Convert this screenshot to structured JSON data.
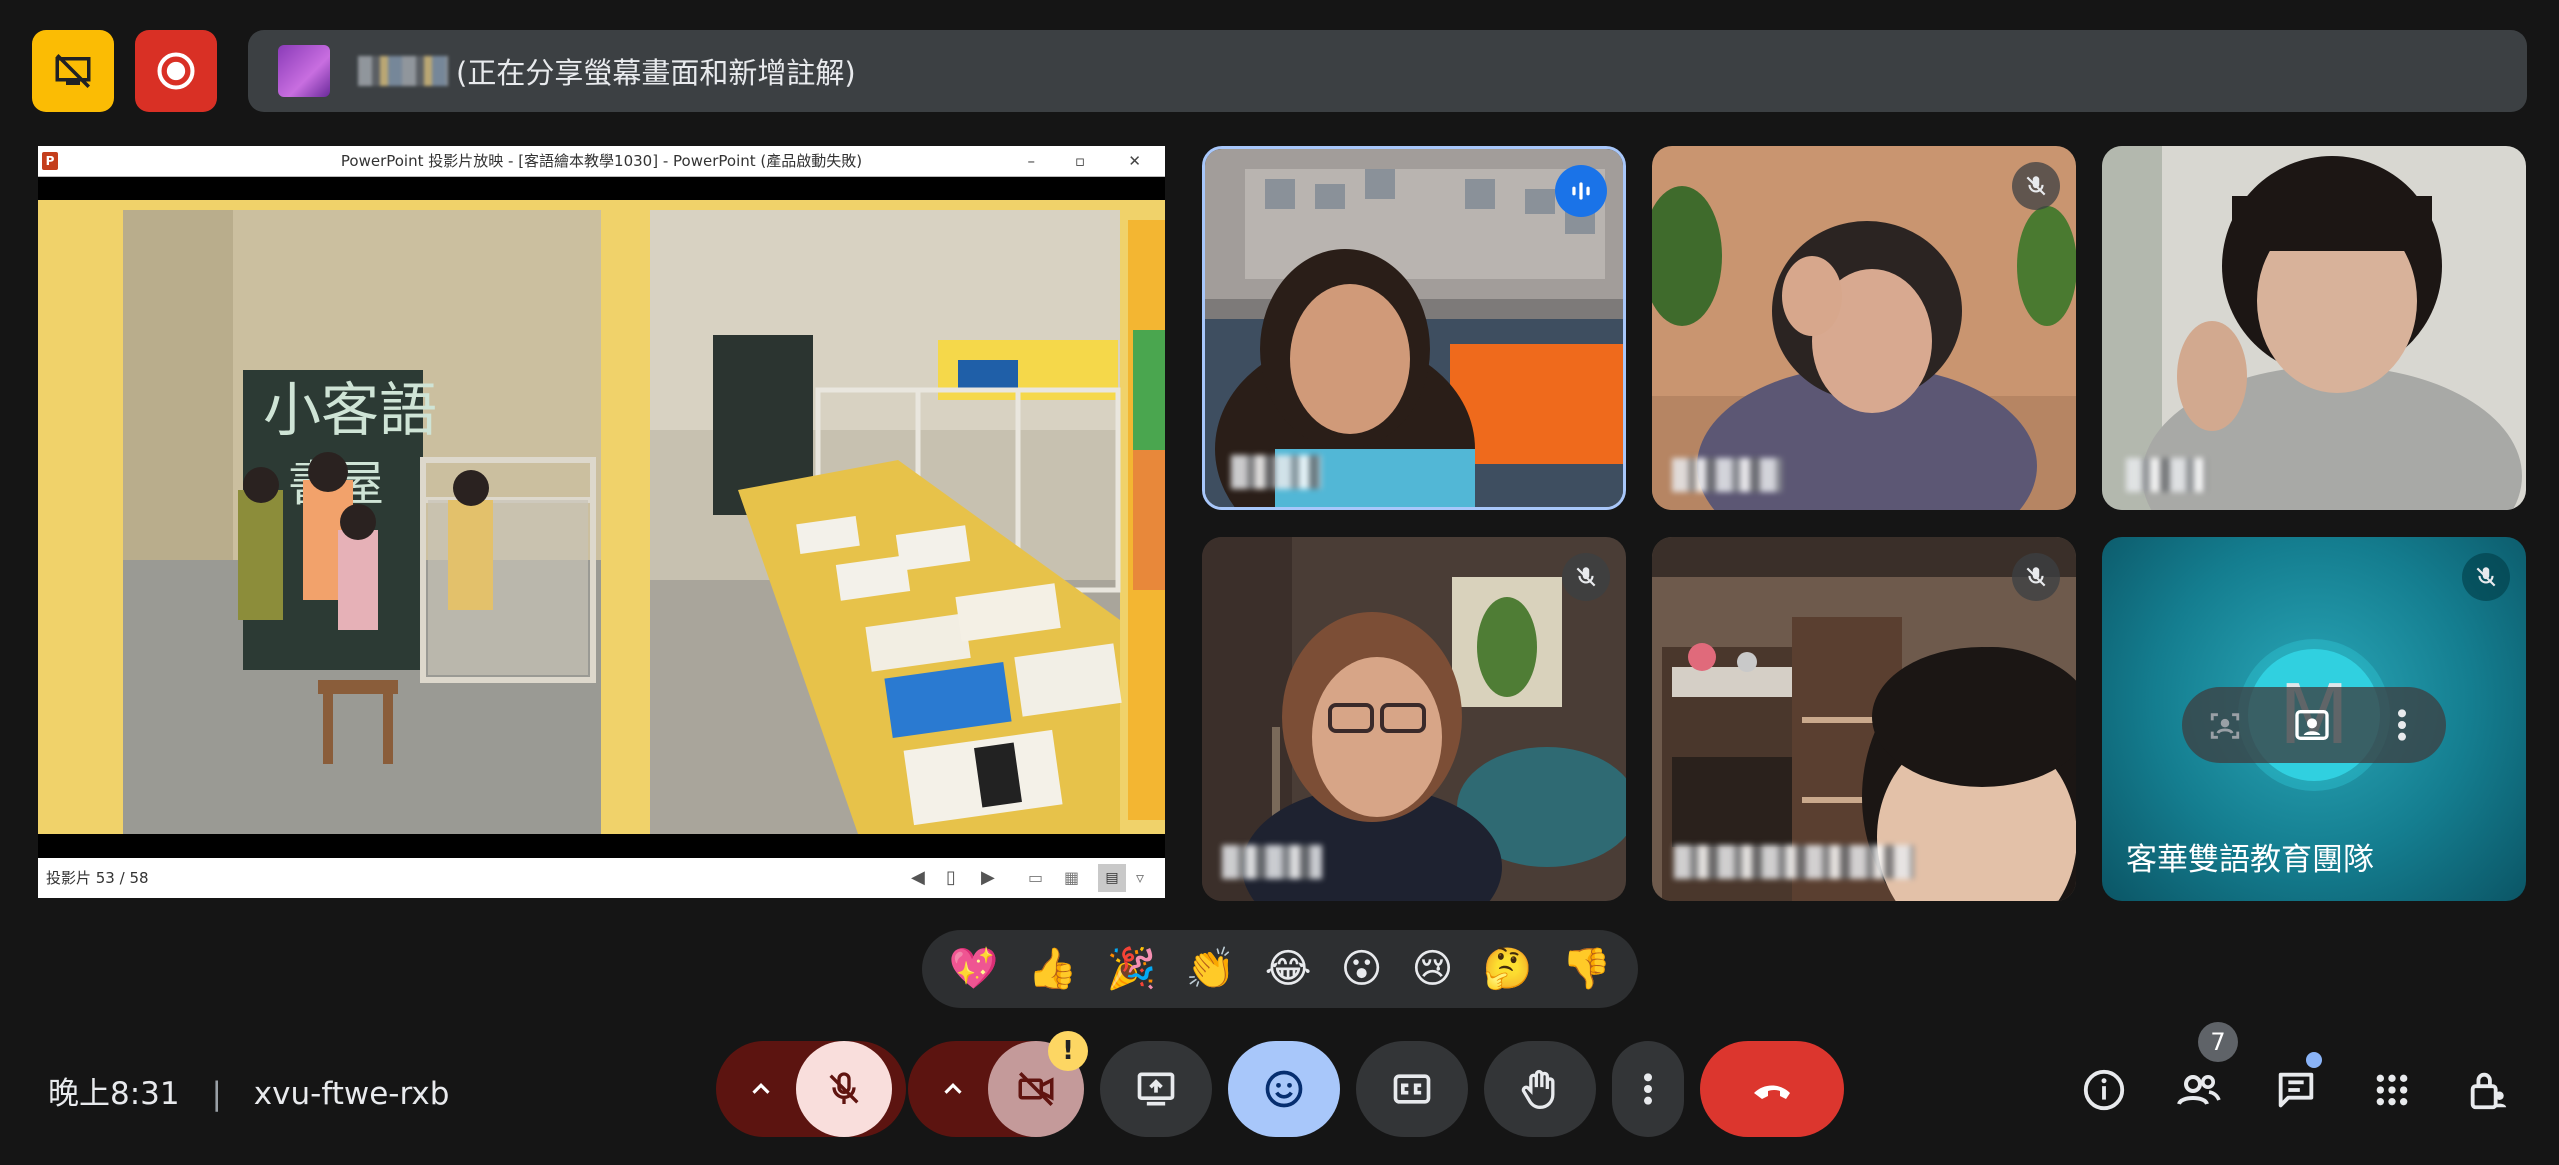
{
  "top": {
    "present_status_icon": "no-presenting-icon",
    "record_icon": "record-icon",
    "share_text": "(正在分享螢幕畫面和新增註解)"
  },
  "presentation": {
    "window_title": "PowerPoint 投影片放映 - [客語繪本教學1030] - PowerPoint (產品啟動失敗)",
    "app_badge": "P",
    "win_min": "–",
    "win_max": "▫",
    "win_close": "✕",
    "slide_status": "投影片 53 / 58",
    "chalk_text_1": "小客語",
    "chalk_text_2": "書屋"
  },
  "tiles": [
    {
      "name": "",
      "speaking": true,
      "muted": false
    },
    {
      "name": "",
      "speaking": false,
      "muted": true
    },
    {
      "name": "",
      "speaking": false,
      "muted": false
    },
    {
      "name": "",
      "speaking": false,
      "muted": true
    },
    {
      "name": "",
      "speaking": false,
      "muted": true
    },
    {
      "name": "客華雙語教育團隊",
      "speaking": false,
      "muted": true,
      "initial": "M"
    }
  ],
  "reactions": [
    "💖",
    "👍",
    "🎉",
    "👏",
    "😂",
    "😮",
    "😢",
    "🤔",
    "👎"
  ],
  "meeting": {
    "time": "晚上8:31",
    "separator": "|",
    "code": "xvu-ftwe-rxb"
  },
  "controls": {
    "camera_warning": "!",
    "participant_count": "7"
  },
  "colors": {
    "danger": "#ea4335",
    "mic_bg": "#f9dedc",
    "accent_blue": "#a8c7fa",
    "record": "#d93025",
    "warning": "#fbbc04"
  }
}
